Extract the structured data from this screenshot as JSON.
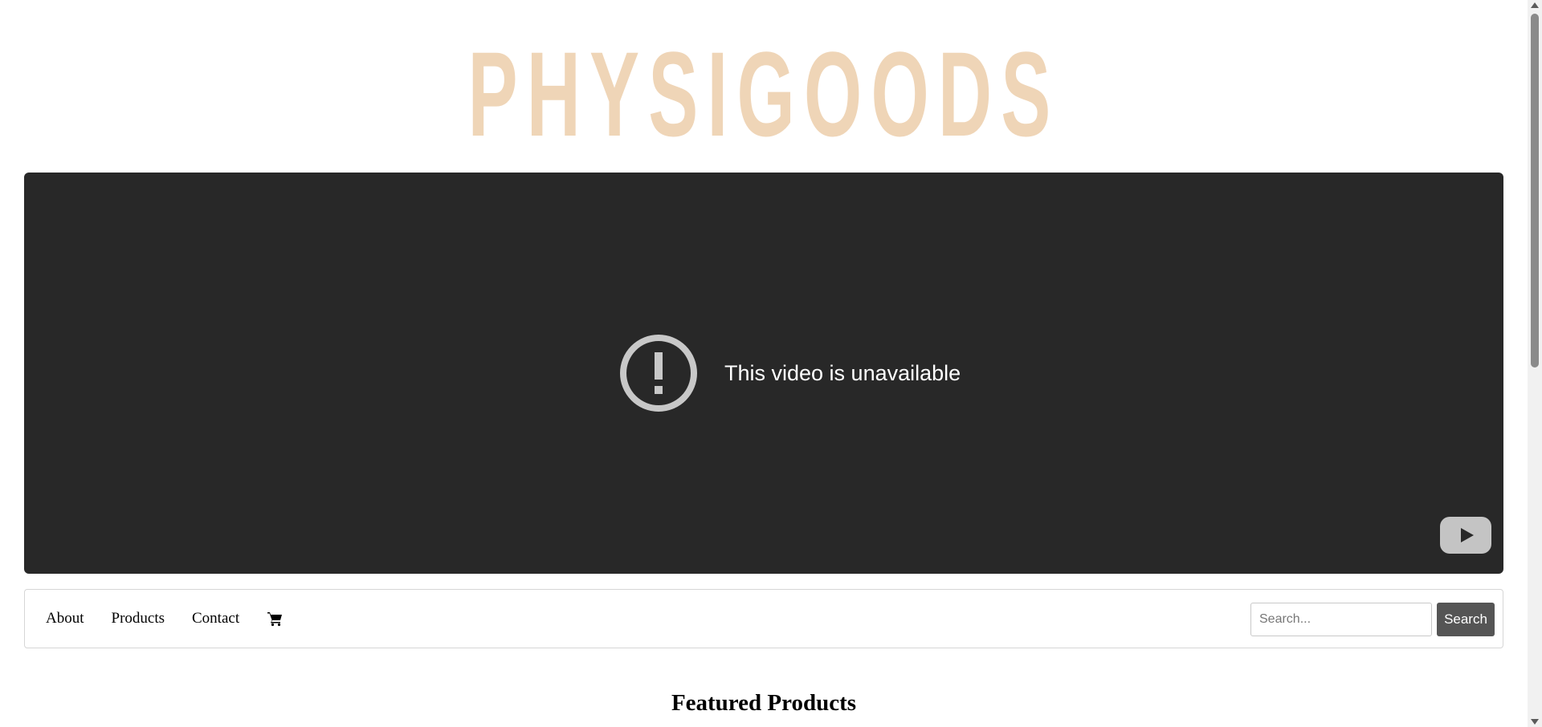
{
  "header": {
    "logo_text": "PHYSIGOODS",
    "logo_color": "#efd5b7"
  },
  "video": {
    "message": "This video is unavailable",
    "warning_icon": "exclamation-circle-icon",
    "player_logo_icon": "youtube-play-icon",
    "background": "#282828"
  },
  "nav": {
    "links": [
      "About",
      "Products",
      "Contact"
    ],
    "cart_icon": "shopping-cart-icon",
    "search_placeholder": "Search...",
    "search_value": "",
    "search_button": "Search"
  },
  "main": {
    "featured_title": "Featured Products"
  },
  "scrollbar": {
    "position": 0
  }
}
